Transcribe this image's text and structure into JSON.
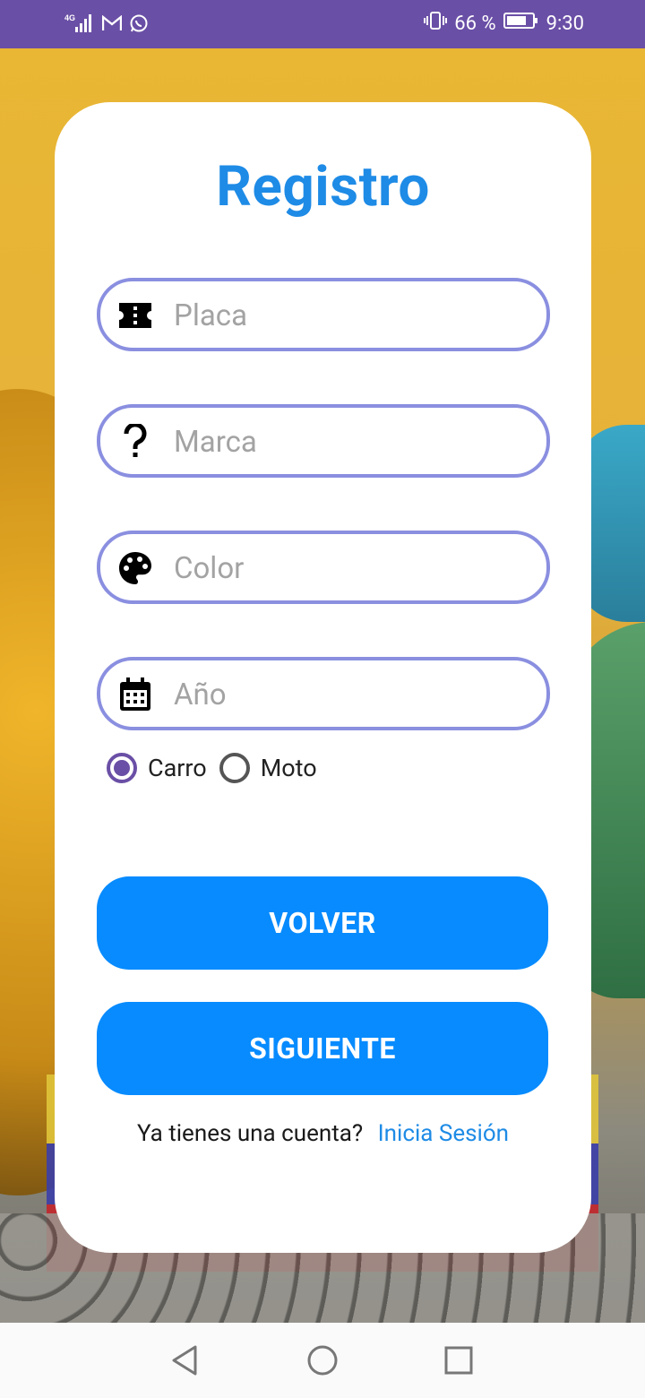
{
  "status_bar": {
    "network_label": "4G",
    "battery_percent": "66 %",
    "time": "9:30",
    "icons": [
      "signal-icon",
      "gmail-icon",
      "whatsapp-icon",
      "vibrate-icon",
      "battery-icon"
    ]
  },
  "form": {
    "title": "Registro",
    "fields": [
      {
        "name": "placa",
        "placeholder": "Placa",
        "icon": "ticket-icon",
        "value": ""
      },
      {
        "name": "marca",
        "placeholder": "Marca",
        "icon": "question-icon",
        "value": ""
      },
      {
        "name": "color",
        "placeholder": "Color",
        "icon": "palette-icon",
        "value": ""
      },
      {
        "name": "anio",
        "placeholder": "Año",
        "icon": "calendar-icon",
        "value": ""
      }
    ],
    "vehicle_type": {
      "options": [
        {
          "label": "Carro",
          "checked": true
        },
        {
          "label": "Moto",
          "checked": false
        }
      ]
    },
    "buttons": {
      "back_label": "VOLVER",
      "next_label": "SIGUIENTE"
    },
    "login_prompt": {
      "question": "Ya tienes una cuenta?",
      "link": "Inicia Sesión"
    }
  },
  "nav_bar": {
    "buttons": [
      "back-icon",
      "home-icon",
      "recents-icon"
    ]
  },
  "colors": {
    "status_bar": "#6a4fa6",
    "title": "#1e8be6",
    "field_border": "#8a8fe0",
    "button": "#078bff",
    "radio_checked": "#6a4fa6",
    "link": "#1e8be6"
  }
}
